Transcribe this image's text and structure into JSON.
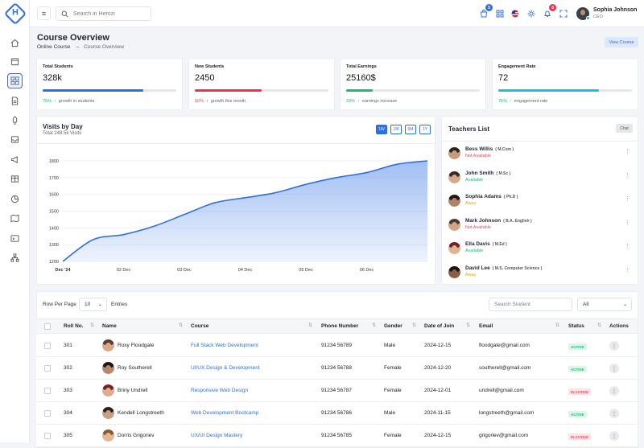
{
  "app": {
    "logo_letter": "H"
  },
  "search": {
    "placeholder": "Search in Herozi"
  },
  "notifications": {
    "cart_count": "5",
    "bell_count": "8"
  },
  "user": {
    "name": "Sophia Johnson",
    "role": "CEO"
  },
  "page": {
    "title": "Course Overview",
    "breadcrumb": [
      "Online Course",
      "Course Overview"
    ],
    "view_button": "View Course"
  },
  "stats": [
    {
      "label": "Total Students",
      "value": "328k",
      "progress": 0.75,
      "pct": "75%",
      "trend": "up",
      "caption": "growth in students",
      "color": "#2f6fe4",
      "pct_color": "green"
    },
    {
      "label": "New Students",
      "value": "2450",
      "progress": 0.5,
      "pct": "50%",
      "trend": "up",
      "caption": "growth this month",
      "color": "#e8344e",
      "pct_color": "red"
    },
    {
      "label": "Total Earnings",
      "value": "25160$",
      "progress": 0.2,
      "pct": "20%",
      "trend": "up",
      "caption": "earnings increase",
      "color": "#1fb873",
      "pct_color": "green"
    },
    {
      "label": "Engagement Rate",
      "value": "72",
      "progress": 0.75,
      "pct": "75%",
      "trend": "up",
      "caption": "engagement rate",
      "color": "#1cc1d6",
      "pct_color": "green"
    }
  ],
  "visits": {
    "title": "Visits by Day",
    "subtitle": "Total 248.5k Visits",
    "ranges": [
      "1W",
      "1M",
      "6M",
      "1Y"
    ],
    "active_range": "1W"
  },
  "chart_data": {
    "type": "area",
    "title": "Visits by Day",
    "x_ticks": [
      "Dec '24",
      "02 Dec",
      "03 Dec",
      "04 Dec",
      "05 Dec",
      "06 Dec"
    ],
    "x": [
      0,
      0.5,
      1,
      1.5,
      2,
      2.5,
      3,
      3.5,
      4,
      4.5,
      5,
      5.5,
      6
    ],
    "y": [
      1200,
      1330,
      1360,
      1410,
      1480,
      1550,
      1580,
      1610,
      1660,
      1700,
      1730,
      1780,
      1800
    ],
    "ylim": [
      1200,
      1800
    ],
    "y_ticks": [
      1200,
      1300,
      1400,
      1500,
      1600,
      1700,
      1800
    ],
    "grid": true,
    "color": "#2f6fe4"
  },
  "teachers": {
    "title": "Teachers List",
    "chat_label": "Chat",
    "items": [
      {
        "name": "Bess Willis",
        "degree": "( M.Com )",
        "status": "Not Available",
        "status_color": "#e74b5c",
        "hair": "#2a2320",
        "skin": "#c99b7c"
      },
      {
        "name": "John Smith",
        "degree": "( M.Sc )",
        "status": "Available",
        "status_color": "#1fb873",
        "hair": "#3b2a1f",
        "skin": "#d6a98a"
      },
      {
        "name": "Sophia Adams",
        "degree": "( Ph.D )",
        "status": "Away",
        "status_color": "#e7a316",
        "hair": "#1f1a17",
        "skin": "#b58163"
      },
      {
        "name": "Mark Johnson",
        "degree": "( B.A. English )",
        "status": "Not Available",
        "status_color": "#e74b5c",
        "hair": "#4a3b30",
        "skin": "#d3a588"
      },
      {
        "name": "Ella Davis",
        "degree": "( M.Ed )",
        "status": "Available",
        "status_color": "#1fb873",
        "hair": "#7a2020",
        "skin": "#e0b394"
      },
      {
        "name": "David Lee",
        "degree": "( M.S. Computer Science )",
        "status": "Away",
        "status_color": "#e7a316",
        "hair": "#1a1411",
        "skin": "#8a5e45"
      }
    ]
  },
  "table": {
    "rows_per_page_label": "Row Per Page",
    "rows_per_page": "10",
    "entries_label": "Entries",
    "search_placeholder": "Search Student",
    "filter_value": "All",
    "columns": [
      "Roll No.",
      "Name",
      "Course",
      "Phone Number",
      "Gender",
      "Date of Join",
      "Email",
      "Status",
      "Actions"
    ],
    "rows": [
      {
        "roll": "301",
        "name": "Roxy Floodgate",
        "course": "Full Stack Web Development",
        "phone": "91234 56789",
        "gender": "Male",
        "date": "2024-12-15",
        "email": "floodgate@gmail.com",
        "status": "ACTIVE",
        "hair": "#5a3d2b",
        "skin": "#d7a88a"
      },
      {
        "roll": "302",
        "name": "Roy Southerell",
        "course": "UI/UX Design & Development",
        "phone": "91234 56788",
        "gender": "Female",
        "date": "2024-12-20",
        "email": "southerell@gmail.com",
        "status": "ACTIVE",
        "hair": "#1c1714",
        "skin": "#b7876b"
      },
      {
        "roll": "303",
        "name": "Briny Undrell",
        "course": "Responsive Web Design",
        "phone": "91234 56787",
        "gender": "Female",
        "date": "2024-12-01",
        "email": "undrell@gmail.com",
        "status": "IN ACTIVE",
        "hair": "#7a1f22",
        "skin": "#dcae90"
      },
      {
        "roll": "304",
        "name": "Kendell Longstreeth",
        "course": "Web Development Bootcamp",
        "phone": "91234 56786",
        "gender": "Male",
        "date": "2024-11-15",
        "email": "longstreeth@gmail.com",
        "status": "ACTIVE",
        "hair": "#2a221d",
        "skin": "#caa084"
      },
      {
        "roll": "305",
        "name": "Dorris Grigoriev",
        "course": "UX/UI Design Mastery",
        "phone": "91234 56785",
        "gender": "Female",
        "date": "2024-12-15",
        "email": "grigoriev@gmail.com",
        "status": "IN ACTIVE",
        "hair": "#8a5a2f",
        "skin": "#e2b697"
      }
    ]
  }
}
